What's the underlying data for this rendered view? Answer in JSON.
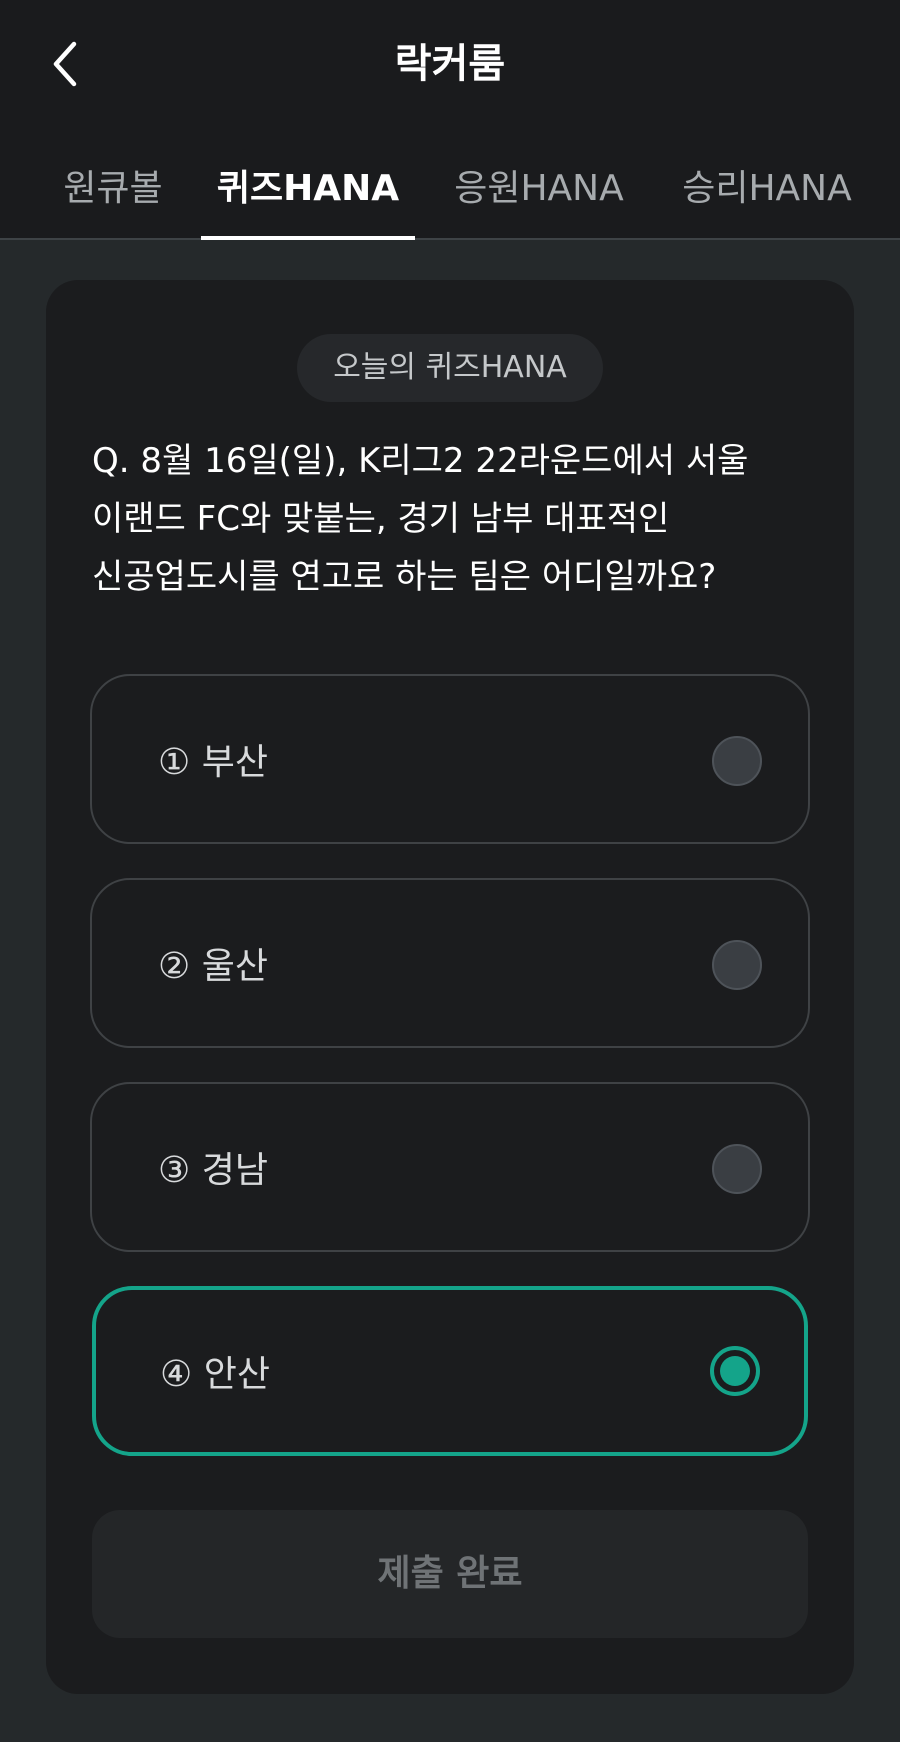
{
  "header": {
    "title": "락커룸",
    "back_icon": "chevron-left-icon"
  },
  "tabs": [
    {
      "label": "원큐볼",
      "active": false
    },
    {
      "label": "퀴즈HANA",
      "active": true
    },
    {
      "label": "응원HANA",
      "active": false
    },
    {
      "label": "승리HANA",
      "active": false
    }
  ],
  "quiz": {
    "badge": "오늘의 퀴즈HANA",
    "question_lines": [
      "Q. 8월 16일(일), K리그2 22라운드에서 서울",
      "이랜드 FC와 맞붙는, 경기 남부 대표적인",
      "신공업도시를 연고로 하는 팀은 어디일까요?"
    ],
    "options": [
      {
        "label": "① 부산",
        "selected": false
      },
      {
        "label": "② 울산",
        "selected": false
      },
      {
        "label": "③ 경남",
        "selected": false
      },
      {
        "label": "④ 안산",
        "selected": true
      }
    ],
    "submit_label": "제출 완료"
  },
  "colors": {
    "accent": "#14a48a",
    "background": "#25292b",
    "card": "#1b1c1e",
    "header": "#1a1b1d"
  }
}
